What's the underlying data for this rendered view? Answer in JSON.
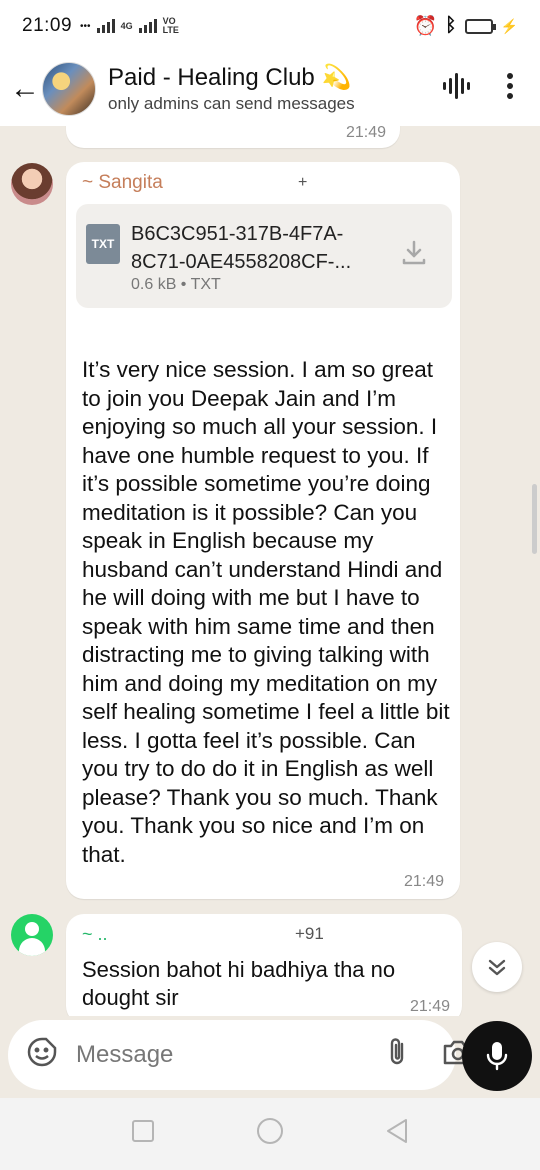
{
  "status_bar": {
    "time": "21:09",
    "network_badge": "4G",
    "volte_badge": "VO LTE"
  },
  "header": {
    "back_icon": "arrow-left-icon",
    "title": "Paid - Healing Club 💫",
    "subtitle": "only admins can send messages",
    "voice_icon": "audio-waveform-icon",
    "menu_icon": "more-vertical-icon"
  },
  "messages": [
    {
      "type": "partial",
      "time": "21:49"
    },
    {
      "sender": "~ Sangita",
      "sender_extra": "+",
      "attachment": {
        "type_label": "TXT",
        "filename": "B6C3C951-317B-4F7A-8C71-0AE4558208CF-...",
        "meta": "0.6 kB • TXT"
      },
      "text": "It’s very nice session. I am so great to join you Deepak Jain and I’m enjoying so much all your session. I have one humble request to you. If it’s possible sometime you’re doing meditation is it possible? Can you speak in English because my husband can’t understand Hindi and he will doing with me but I have to speak with him same time and then distracting me to giving talking with him and doing my meditation on my self healing sometime I feel a little bit less. I gotta feel it’s possible. Can you try to do do it in English as well please? Thank you so much. Thank you. Thank you so nice and I’m on that.",
      "time": "21:49"
    },
    {
      "sender": "~ ..",
      "phone": "+91",
      "text": "Session bahot hi badhiya tha no dought sir",
      "time": "21:49"
    }
  ],
  "input": {
    "placeholder": "Message"
  },
  "colors": {
    "chat_bg": "#efeae2",
    "sender1": "#c57e5a",
    "sender2": "#25b86a",
    "mic_bg": "#111111"
  }
}
